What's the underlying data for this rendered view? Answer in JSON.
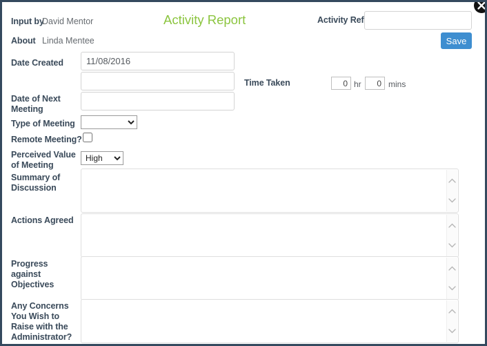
{
  "dialog": {
    "title": "Activity Report",
    "title_color": "#8cc540",
    "border_color": "#34495e",
    "close_icon": "close-icon"
  },
  "header": {
    "input_by_label": "Input by",
    "input_by_value": "David Mentor",
    "about_label": "About",
    "about_value": "Linda Mentee",
    "activity_ref_label": "Activity Ref",
    "activity_ref_value": "",
    "activity_ref_placeholder": "",
    "save_label": "Save",
    "save_color": "#3e8ed0"
  },
  "fields": {
    "date_created_label": "Date Created",
    "date_created_value": "11/08/2016",
    "date_secondary_value": "",
    "date_next_meeting_label": "Date of Next Meeting",
    "date_next_meeting_value": "",
    "time_taken_label": "Time Taken",
    "time_hours_value": "0",
    "time_hours_unit": "hr",
    "time_mins_value": "0",
    "time_mins_unit": "mins",
    "type_of_meeting_label": "Type of Meeting",
    "type_of_meeting_value": "",
    "type_of_meeting_options": [
      ""
    ],
    "remote_meeting_label": "Remote Meeting?",
    "remote_meeting_checked": false,
    "perceived_value_label": "Perceived Value of Meeting",
    "perceived_value_value": "High",
    "perceived_value_options": [
      "High"
    ]
  },
  "textareas": [
    {
      "label": "Summary of Discussion",
      "value": "",
      "name": "summary-of-discussion"
    },
    {
      "label": "Actions Agreed",
      "value": "",
      "name": "actions-agreed"
    },
    {
      "label": "Progress against Objectives",
      "value": "",
      "name": "progress-against-objectives"
    },
    {
      "label": "Any Concerns You Wish to Raise with the Administrator?",
      "value": "",
      "name": "any-concerns"
    }
  ]
}
